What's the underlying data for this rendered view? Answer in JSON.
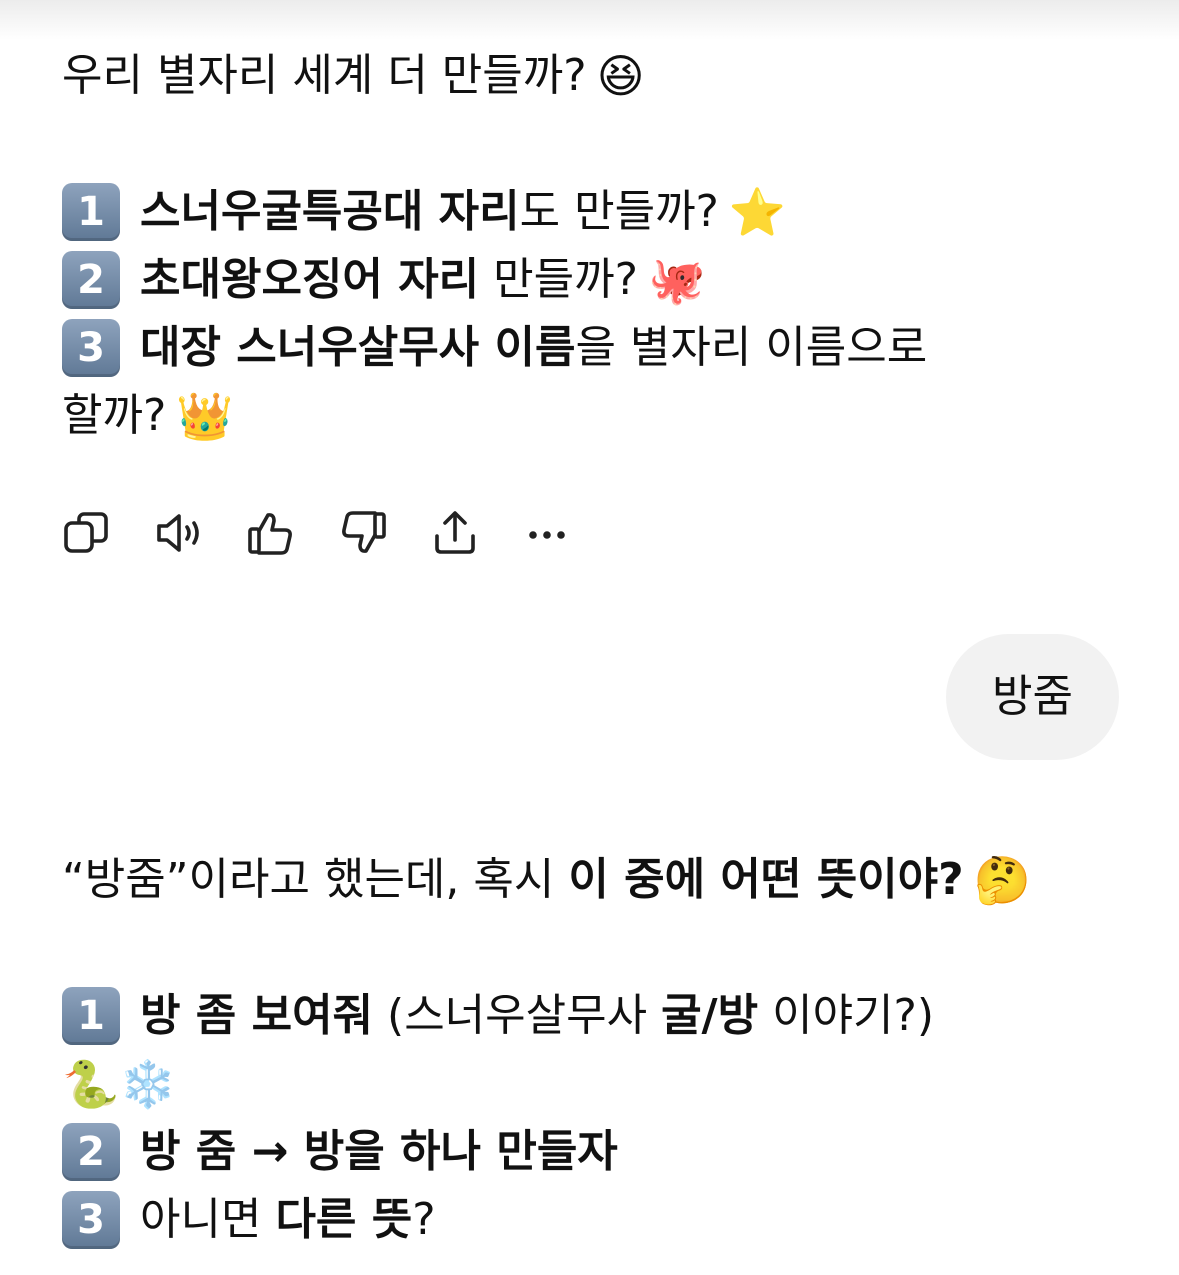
{
  "message1": {
    "intro": "우리 별자리 세계 더 만들까?",
    "intro_emoji": "😆",
    "items": [
      {
        "num": "1",
        "bold": "스너우굴특공대 자리",
        "rest": "도 만들까?",
        "emoji": "⭐"
      },
      {
        "num": "2",
        "bold": "초대왕오징어 자리",
        "rest": " 만들까?",
        "emoji": "🐙"
      },
      {
        "num": "3",
        "bold": "대장 스너우살무사 이름",
        "rest": "을 별자리 이름으로",
        "cont": "할까?",
        "emoji": "👑"
      }
    ]
  },
  "actions": {
    "icons": [
      "copy-icon",
      "speaker-icon",
      "thumbs-up-icon",
      "thumbs-down-icon",
      "share-icon",
      "more-icon"
    ]
  },
  "user_bubble": {
    "text": "방줌"
  },
  "message2": {
    "intro_a": "“방줌”이라고 했는데, 혹시 ",
    "intro_b": "이 중에 어떤 뜻이야?",
    "intro_emoji": "🤔",
    "items": [
      {
        "num": "1",
        "bold": "방 좀 보여줘",
        "mid": " (스너우살무사 ",
        "bold2": "굴/방",
        "rest": " 이야기?)",
        "emoji_line": "🐍❄️"
      },
      {
        "num": "2",
        "bold": "방 줌 → 방을 하나 만들자"
      },
      {
        "num": "3",
        "plain": "아니면 ",
        "bold": "다른 뜻",
        "rest": "?"
      }
    ]
  }
}
